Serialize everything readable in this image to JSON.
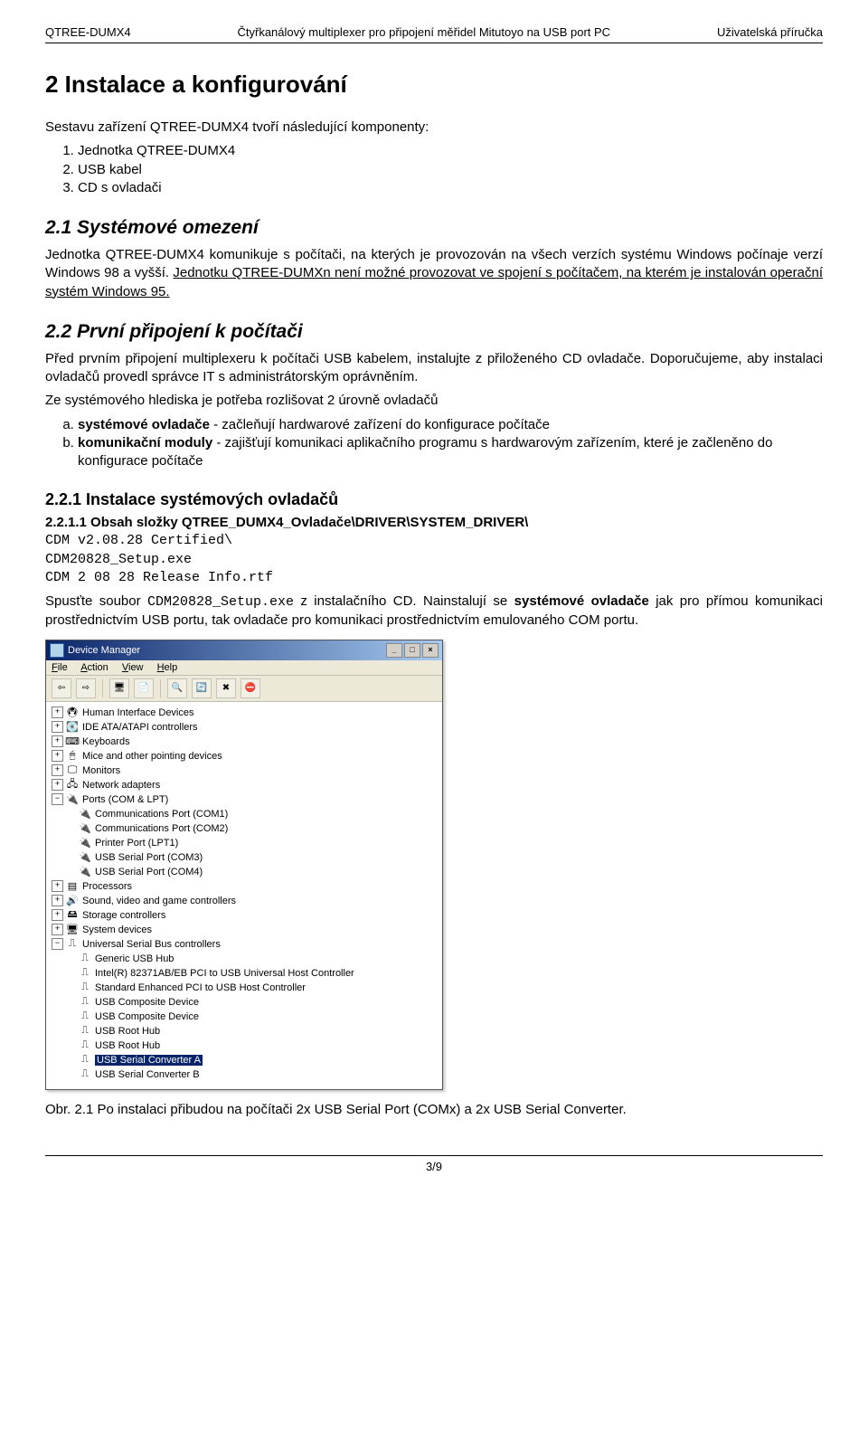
{
  "header": {
    "left": "QTREE-DUMX4",
    "center": "Čtyřkanálový multiplexer pro připojení měřidel Mitutoyo na USB port PC",
    "right": "Uživatelská příručka"
  },
  "sec2": {
    "title": "2   Instalace a konfigurování",
    "intro": "Sestavu zařízení QTREE-DUMX4 tvoří následující komponenty:",
    "components": [
      "Jednotka QTREE-DUMX4",
      "USB kabel",
      "CD s ovladači"
    ]
  },
  "s21": {
    "title": "2.1   Systémové omezení",
    "p1a": "Jednotka QTREE-DUMX4 komunikuje s počítači, na kterých je provozován na všech verzích systému Windows počínaje verzí Windows 98 a vyšší. ",
    "p1b": "Jednotku QTREE-DUMXn není možné provozovat ve spojení s počítačem, na kterém je instalován operační systém Windows 95."
  },
  "s22": {
    "title": "2.2   První připojení k počítači",
    "p1": "Před prvním připojení multiplexeru k počítači USB kabelem, instalujte z přiloženého CD ovladače. Doporučujeme, aby instalaci ovladačů provedl správce IT s administrátorským oprávněním.",
    "p2": "Ze systémového hlediska je potřeba rozlišovat 2 úrovně ovladačů",
    "li_a_pre": "systémové ovladače",
    "li_a_post": " - začleňují hardwarové zařízení do konfigurace počítače",
    "li_b_pre": "komunikační moduly",
    "li_b_post": " - zajišťují komunikaci aplikačního programu s hardwarovým zařízením, které je začleněno do konfigurace počítače"
  },
  "s221": {
    "title": "2.2.1   Instalace systémových ovladačů",
    "s4": "2.2.1.1    Obsah složky QTREE_DUMX4_Ovladače\\DRIVER\\SYSTEM_DRIVER\\",
    "code1": "CDM v2.08.28 Certified\\",
    "code2": "CDM20828_Setup.exe",
    "code3": "CDM 2 08 28 Release Info.rtf",
    "p_a": "Spusťte soubor ",
    "p_code": "CDM20828_Setup.exe",
    "p_b": " z instalačního CD. Nainstalují se ",
    "p_bold": "systémové ovladače",
    "p_c": " jak pro přímou komunikaci prostřednictvím USB portu, tak ovladače pro komunikaci prostřednictvím emulovaného COM portu."
  },
  "dm": {
    "title": "Device Manager",
    "menus": [
      "File",
      "Action",
      "View",
      "Help"
    ],
    "tree": {
      "hid": "Human Interface Devices",
      "ide": "IDE ATA/ATAPI controllers",
      "kbd": "Keyboards",
      "mice": "Mice and other pointing devices",
      "mon": "Monitors",
      "net": "Network adapters",
      "ports": "Ports (COM & LPT)",
      "com1": "Communications Port (COM1)",
      "com2": "Communications Port (COM2)",
      "lpt1": "Printer Port (LPT1)",
      "usb3": "USB Serial Port (COM3)",
      "usb4": "USB Serial Port (COM4)",
      "cpu": "Processors",
      "snd": "Sound, video and game controllers",
      "stor": "Storage controllers",
      "sys": "System devices",
      "usb": "Universal Serial Bus controllers",
      "ghub": "Generic USB Hub",
      "intel": "Intel(R) 82371AB/EB PCI to USB Universal Host Controller",
      "std": "Standard Enhanced PCI to USB Host Controller",
      "comp1": "USB Composite Device",
      "comp2": "USB Composite Device",
      "root1": "USB Root Hub",
      "root2": "USB Root Hub",
      "convA": "USB Serial Converter A",
      "convB": "USB Serial Converter B"
    }
  },
  "fig": "Obr. 2.1 Po instalaci přibudou na počítači 2x USB Serial Port (COMx) a 2x USB Serial Converter.",
  "pager": "3/9"
}
